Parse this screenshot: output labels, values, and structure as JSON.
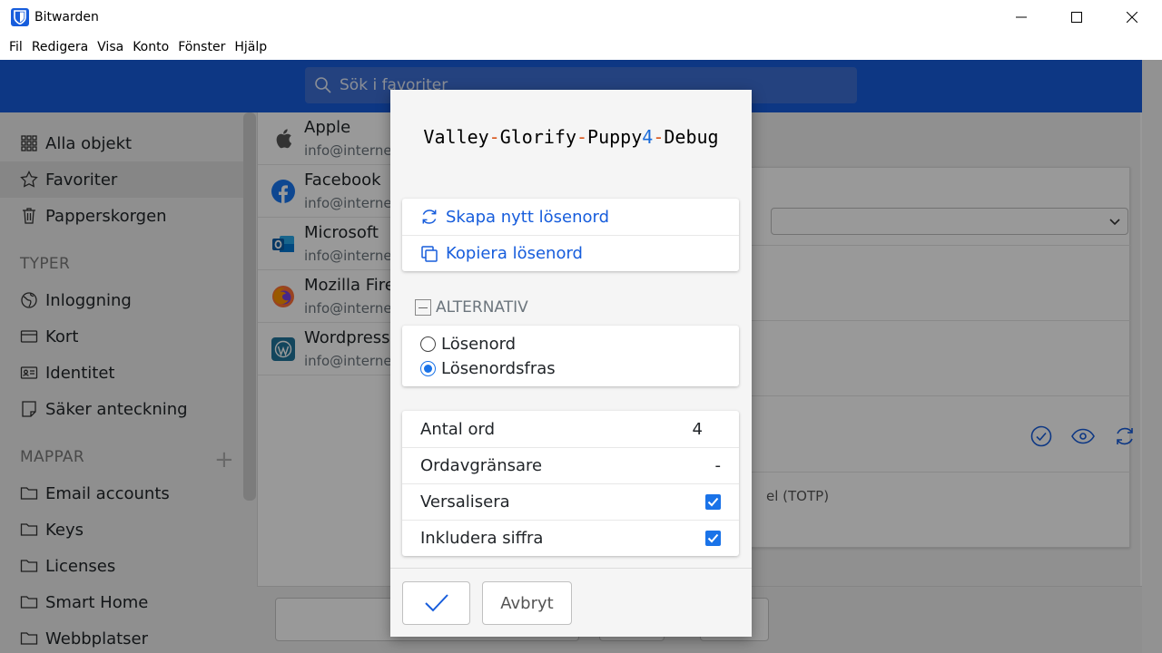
{
  "window": {
    "title": "Bitwarden",
    "logo_icon": "bitwarden-shield-icon"
  },
  "menubar": {
    "items": [
      "Fil",
      "Redigera",
      "Visa",
      "Konto",
      "Fönster",
      "Hjälp"
    ]
  },
  "header": {
    "search_placeholder": "Sök i favoriter",
    "color": "#175ddc"
  },
  "sidebar": {
    "filters": [
      {
        "label": "Alla objekt",
        "icon": "grid-icon"
      },
      {
        "label": "Favoriter",
        "icon": "star-icon",
        "active": true
      },
      {
        "label": "Papperskorgen",
        "icon": "trash-icon"
      }
    ],
    "types_header": "TYPER",
    "types": [
      {
        "label": "Inloggning",
        "icon": "globe-icon"
      },
      {
        "label": "Kort",
        "icon": "credit-card-icon"
      },
      {
        "label": "Identitet",
        "icon": "id-card-icon"
      },
      {
        "label": "Säker anteckning",
        "icon": "note-icon"
      }
    ],
    "folders_header": "MAPPAR",
    "add_folder": "+",
    "folders": [
      {
        "label": "Email accounts",
        "icon": "folder-icon"
      },
      {
        "label": "Keys",
        "icon": "folder-icon"
      },
      {
        "label": "Licenses",
        "icon": "folder-icon"
      },
      {
        "label": "Smart Home",
        "icon": "folder-icon"
      },
      {
        "label": "Webbplatser",
        "icon": "folder-icon"
      }
    ]
  },
  "items": [
    {
      "name": "Apple",
      "sub": "info@interne",
      "icon": "apple-icon"
    },
    {
      "name": "Facebook",
      "sub": "info@interne",
      "icon": "facebook-icon"
    },
    {
      "name": "Microsoft",
      "sub": "info@interne",
      "icon": "outlook-icon"
    },
    {
      "name": "Mozilla Fire",
      "sub": "info@interne",
      "icon": "firefox-icon"
    },
    {
      "name": "Wordpress",
      "sub": "info@interne",
      "icon": "wordpress-icon"
    }
  ],
  "detail": {
    "totp_label": "el (TOTP)"
  },
  "generator": {
    "password_parts": [
      {
        "text": "Valley",
        "kind": "word"
      },
      {
        "text": "-",
        "kind": "sep"
      },
      {
        "text": "Glorify",
        "kind": "word"
      },
      {
        "text": "-",
        "kind": "sep"
      },
      {
        "text": "Puppy",
        "kind": "word"
      },
      {
        "text": "4",
        "kind": "num"
      },
      {
        "text": "-",
        "kind": "sep"
      },
      {
        "text": "Debug",
        "kind": "word"
      }
    ],
    "regenerate_label": "Skapa nytt lösenord",
    "copy_label": "Kopiera lösenord",
    "options_header": "ALTERNATIV",
    "type_password": "Lösenord",
    "type_passphrase": "Lösenordsfras",
    "selected_type": "passphrase",
    "num_words_label": "Antal ord",
    "num_words_value": "4",
    "separator_label": "Ordavgränsare",
    "separator_value": "-",
    "capitalize_label": "Versalisera",
    "capitalize_checked": true,
    "include_number_label": "Inkludera siffra",
    "include_number_checked": true,
    "cancel_label": "Avbryt"
  }
}
